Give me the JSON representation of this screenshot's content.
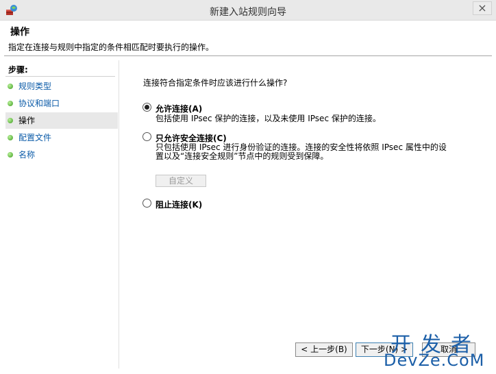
{
  "window": {
    "title": "新建入站规则向导",
    "close_label": "×"
  },
  "header": {
    "title": "操作",
    "description": "指定在连接与规则中指定的条件相匹配时要执行的操作。"
  },
  "steps": {
    "header": "步骤:",
    "items": [
      {
        "label": "规则类型"
      },
      {
        "label": "协议和端口"
      },
      {
        "label": "操作"
      },
      {
        "label": "配置文件"
      },
      {
        "label": "名称"
      }
    ]
  },
  "main": {
    "question": "连接符合指定条件时应该进行什么操作?",
    "options": [
      {
        "label": "允许连接(A)",
        "desc": "包括使用 IPsec 保护的连接，以及未使用 IPsec 保护的连接。",
        "selected": true
      },
      {
        "label": "只允许安全连接(C)",
        "desc_line1": "只包括使用 IPsec 进行身份验证的连接。连接的安全性将依照 IPsec 属性中的设",
        "desc_line2": "置以及“连接安全规则”节点中的规则受到保障。",
        "selected": false
      },
      {
        "label": "阻止连接(K)",
        "selected": false
      }
    ],
    "customize_label": "自定义"
  },
  "footer": {
    "back_label": "< 上一步(B)",
    "next_label": "下一步(N) >",
    "cancel_label": "取消"
  },
  "watermark": {
    "line1": "开发者",
    "line2": "DevZe.CoM"
  }
}
